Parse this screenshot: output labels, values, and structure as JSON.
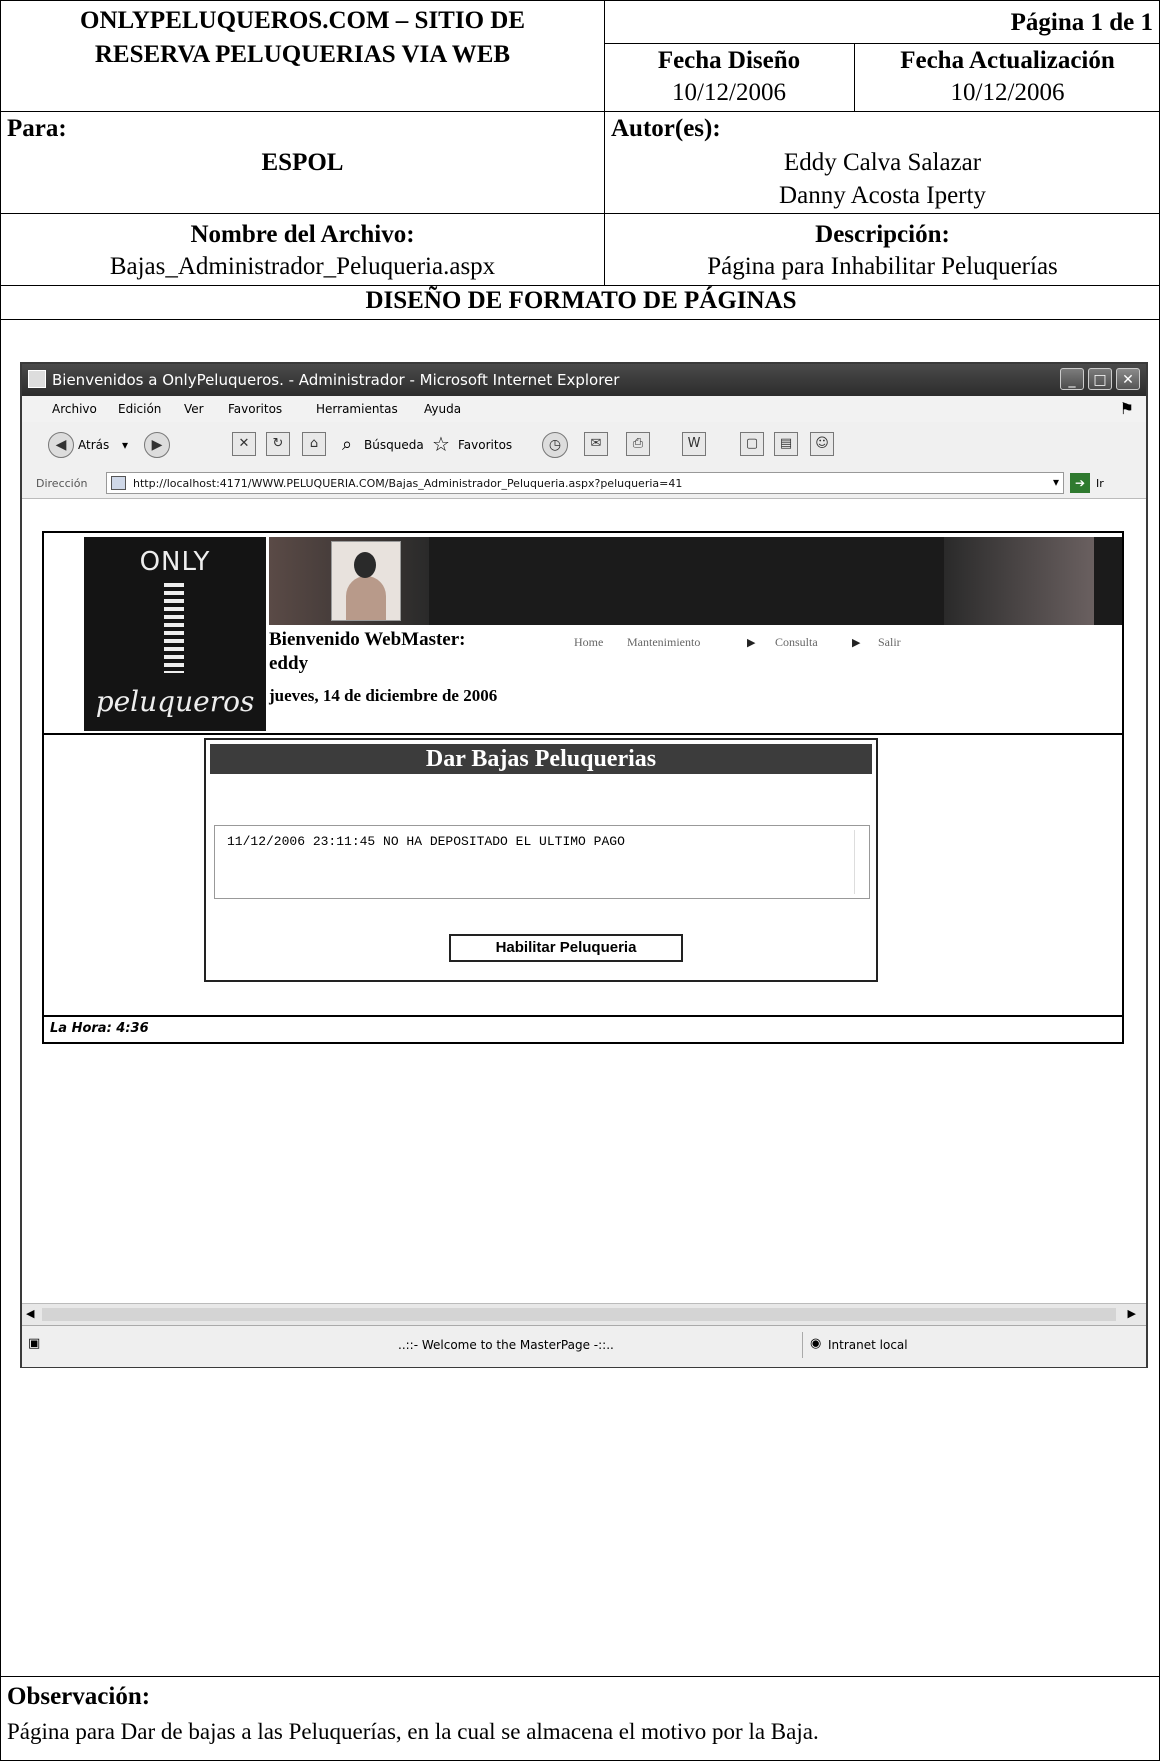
{
  "document": {
    "project_title_line1": "ONLYPELUQUEROS.COM – SITIO DE",
    "project_title_line2": "RESERVA PELUQUERIAS VIA WEB",
    "page_label": "Página 1 de 1",
    "fecha_diseno_label": "Fecha Diseño",
    "fecha_diseno_value": "10/12/2006",
    "fecha_actualizacion_label": "Fecha Actualización",
    "fecha_actualizacion_value": "10/12/2006",
    "para_label": "Para:",
    "para_value": "ESPOL",
    "autores_label": "Autor(es):",
    "autor_1": "Eddy Calva Salazar",
    "autor_2": "Danny Acosta Iperty",
    "archivo_label": "Nombre del Archivo:",
    "archivo_value": "Bajas_Administrador_Peluqueria.aspx",
    "descripcion_label": "Descripción:",
    "descripcion_value": "Página  para Inhabilitar Peluquerías",
    "section_title": "DISEÑO DE FORMATO DE PÁGINAS",
    "observacion_label": "Observación:",
    "observacion_value": "Página para Dar de bajas a las Peluquerías, en la cual se almacena el motivo por la Baja."
  },
  "browser": {
    "title": "Bienvenidos a OnlyPeluqueros. - Administrador - Microsoft Internet Explorer",
    "menu": [
      "Archivo",
      "Edición",
      "Ver",
      "Favoritos",
      "Herramientas",
      "Ayuda"
    ],
    "toolbar": {
      "back_label": "Atrás",
      "search_label": "Búsqueda",
      "favorites_label": "Favoritos"
    },
    "address_label": "Dirección",
    "url": "http://localhost:4171/WWW.PELUQUERIA.COM/Bajas_Administrador_Peluqueria.aspx?peluqueria=41",
    "go_label": "Ir",
    "status_message": "..::- Welcome to the MasterPage -::..",
    "status_zone": "Intranet local"
  },
  "site": {
    "logo_top": "ONLY",
    "logo_bottom": "peluqueros",
    "welcome": "Bienvenido WebMaster:",
    "username": "eddy",
    "date": "jueves, 14 de diciembre de 2006",
    "nav": [
      "Home",
      "Mantenimiento",
      "Consulta",
      "Salir"
    ],
    "panel_title": "Dar Bajas Peluquerias",
    "reason_text": "11/12/2006 23:11:45 NO HA DEPOSITADO EL ULTIMO PAGO",
    "enable_button": "Habilitar Peluqueria",
    "clock": "La Hora: 4:36"
  }
}
